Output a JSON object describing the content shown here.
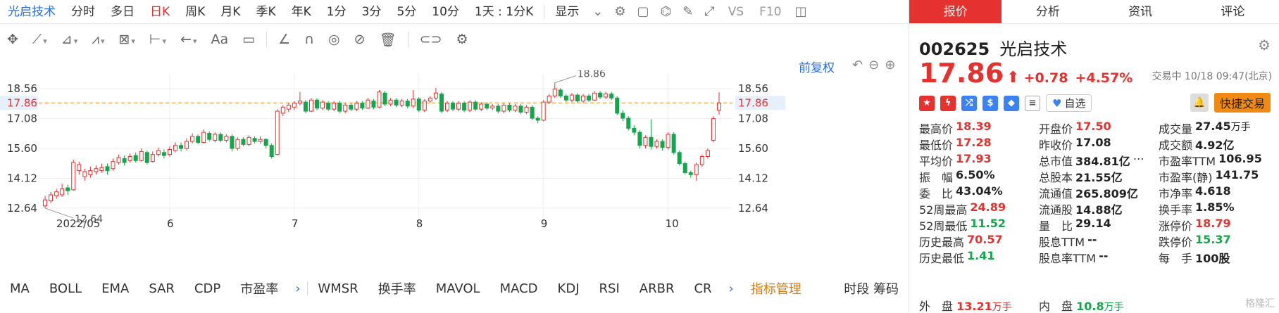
{
  "topbar": {
    "stock_name": "光启技术",
    "periods": [
      "分时",
      "多日",
      "日K",
      "周K",
      "月K",
      "季K",
      "年K",
      "1分",
      "3分",
      "5分",
      "10分",
      "1天 : 1分K"
    ],
    "selected": "日K",
    "display_label": "显示",
    "vs_label": "VS",
    "f10_label": "F10"
  },
  "adjust": {
    "label": "前复权"
  },
  "chart": {
    "price_levels": [
      "18.56",
      "17.08",
      "15.60",
      "14.12",
      "12.64"
    ],
    "current_price_label": "17.86",
    "high_label": "18.86",
    "low_label": "12.64",
    "months": [
      "2022/05",
      "6",
      "7",
      "8",
      "9",
      "10"
    ],
    "accent_up": "#e5322e",
    "accent_down": "#15a64b"
  },
  "chart_data": {
    "type": "candlestick",
    "y_range": [
      11.8,
      19.3
    ],
    "current": 17.86,
    "max_marker": 18.86,
    "min_marker": 12.64,
    "candles": [
      {
        "o": 12.75,
        "c": 13.05,
        "h": 13.25,
        "l": 12.64
      },
      {
        "o": 13.0,
        "c": 13.3,
        "h": 13.45,
        "l": 12.9
      },
      {
        "o": 13.25,
        "c": 13.45,
        "h": 13.6,
        "l": 13.1
      },
      {
        "o": 13.3,
        "c": 13.6,
        "h": 13.85,
        "l": 13.2
      },
      {
        "o": 13.65,
        "c": 13.5,
        "h": 13.8,
        "l": 13.3
      },
      {
        "o": 13.55,
        "c": 14.9,
        "h": 15.05,
        "l": 13.5
      },
      {
        "o": 14.5,
        "c": 14.8,
        "h": 14.95,
        "l": 14.3
      },
      {
        "o": 14.2,
        "c": 14.45,
        "h": 14.6,
        "l": 14.0
      },
      {
        "o": 14.3,
        "c": 14.5,
        "h": 14.7,
        "l": 14.15
      },
      {
        "o": 14.45,
        "c": 14.6,
        "h": 14.75,
        "l": 14.3
      },
      {
        "o": 14.5,
        "c": 14.65,
        "h": 14.85,
        "l": 14.4
      },
      {
        "o": 14.7,
        "c": 14.5,
        "h": 14.85,
        "l": 14.3
      },
      {
        "o": 14.6,
        "c": 14.95,
        "h": 15.1,
        "l": 14.5
      },
      {
        "o": 14.9,
        "c": 15.15,
        "h": 15.3,
        "l": 14.8
      },
      {
        "o": 15.1,
        "c": 14.9,
        "h": 15.25,
        "l": 14.75
      },
      {
        "o": 15.0,
        "c": 15.2,
        "h": 15.35,
        "l": 14.9
      },
      {
        "o": 15.25,
        "c": 15.0,
        "h": 15.4,
        "l": 14.9
      },
      {
        "o": 15.0,
        "c": 15.45,
        "h": 15.6,
        "l": 14.95
      },
      {
        "o": 15.4,
        "c": 14.9,
        "h": 15.5,
        "l": 14.8
      },
      {
        "o": 14.95,
        "c": 15.3,
        "h": 15.45,
        "l": 14.9
      },
      {
        "o": 15.3,
        "c": 15.5,
        "h": 15.65,
        "l": 15.2
      },
      {
        "o": 15.4,
        "c": 15.25,
        "h": 15.55,
        "l": 15.1
      },
      {
        "o": 15.3,
        "c": 15.55,
        "h": 15.7,
        "l": 15.2
      },
      {
        "o": 15.5,
        "c": 15.75,
        "h": 15.9,
        "l": 15.4
      },
      {
        "o": 15.75,
        "c": 15.6,
        "h": 15.9,
        "l": 15.45
      },
      {
        "o": 15.6,
        "c": 15.95,
        "h": 16.1,
        "l": 15.5
      },
      {
        "o": 15.95,
        "c": 16.2,
        "h": 16.35,
        "l": 15.85
      },
      {
        "o": 16.2,
        "c": 15.9,
        "h": 16.3,
        "l": 15.8
      },
      {
        "o": 15.9,
        "c": 16.4,
        "h": 16.55,
        "l": 15.85
      },
      {
        "o": 16.35,
        "c": 16.05,
        "h": 16.45,
        "l": 15.95
      },
      {
        "o": 16.0,
        "c": 16.3,
        "h": 16.4,
        "l": 15.9
      },
      {
        "o": 16.3,
        "c": 16.0,
        "h": 16.4,
        "l": 15.9
      },
      {
        "o": 16.0,
        "c": 16.2,
        "h": 16.3,
        "l": 15.9
      },
      {
        "o": 16.2,
        "c": 15.6,
        "h": 16.3,
        "l": 15.45
      },
      {
        "o": 15.6,
        "c": 16.05,
        "h": 16.15,
        "l": 15.5
      },
      {
        "o": 16.05,
        "c": 15.8,
        "h": 16.15,
        "l": 15.7
      },
      {
        "o": 15.8,
        "c": 16.15,
        "h": 16.25,
        "l": 15.7
      },
      {
        "o": 16.1,
        "c": 15.95,
        "h": 16.2,
        "l": 15.85
      },
      {
        "o": 15.95,
        "c": 16.05,
        "h": 16.2,
        "l": 15.85
      },
      {
        "o": 16.05,
        "c": 15.75,
        "h": 16.1,
        "l": 15.6
      },
      {
        "o": 15.75,
        "c": 15.2,
        "h": 15.85,
        "l": 15.1
      },
      {
        "o": 15.3,
        "c": 17.45,
        "h": 17.55,
        "l": 15.25
      },
      {
        "o": 17.35,
        "c": 17.65,
        "h": 17.75,
        "l": 17.2
      },
      {
        "o": 17.55,
        "c": 17.75,
        "h": 17.85,
        "l": 17.4
      },
      {
        "o": 17.65,
        "c": 17.85,
        "h": 17.95,
        "l": 17.5
      },
      {
        "o": 17.85,
        "c": 17.95,
        "h": 18.4,
        "l": 17.75
      },
      {
        "o": 17.9,
        "c": 17.45,
        "h": 18.0,
        "l": 17.35
      },
      {
        "o": 17.45,
        "c": 18.0,
        "h": 18.1,
        "l": 17.4
      },
      {
        "o": 18.0,
        "c": 17.6,
        "h": 18.1,
        "l": 17.5
      },
      {
        "o": 17.6,
        "c": 17.9,
        "h": 18.0,
        "l": 17.5
      },
      {
        "o": 17.85,
        "c": 17.55,
        "h": 17.95,
        "l": 17.45
      },
      {
        "o": 17.55,
        "c": 17.85,
        "h": 17.95,
        "l": 17.45
      },
      {
        "o": 17.85,
        "c": 17.45,
        "h": 17.95,
        "l": 17.35
      },
      {
        "o": 17.45,
        "c": 17.75,
        "h": 17.85,
        "l": 17.35
      },
      {
        "o": 17.75,
        "c": 17.55,
        "h": 17.85,
        "l": 17.45
      },
      {
        "o": 17.55,
        "c": 17.85,
        "h": 17.95,
        "l": 17.45
      },
      {
        "o": 17.85,
        "c": 17.6,
        "h": 17.95,
        "l": 17.5
      },
      {
        "o": 17.6,
        "c": 18.0,
        "h": 18.1,
        "l": 17.55
      },
      {
        "o": 17.95,
        "c": 17.65,
        "h": 18.05,
        "l": 17.55
      },
      {
        "o": 17.65,
        "c": 18.4,
        "h": 18.5,
        "l": 17.6
      },
      {
        "o": 18.35,
        "c": 17.8,
        "h": 18.45,
        "l": 17.7
      },
      {
        "o": 17.8,
        "c": 18.0,
        "h": 18.1,
        "l": 17.7
      },
      {
        "o": 18.0,
        "c": 17.75,
        "h": 18.1,
        "l": 17.65
      },
      {
        "o": 17.75,
        "c": 17.95,
        "h": 18.05,
        "l": 17.65
      },
      {
        "o": 17.95,
        "c": 17.7,
        "h": 18.05,
        "l": 17.6
      },
      {
        "o": 17.7,
        "c": 18.05,
        "h": 18.5,
        "l": 17.6
      },
      {
        "o": 18.05,
        "c": 17.5,
        "h": 18.15,
        "l": 17.4
      },
      {
        "o": 17.5,
        "c": 17.95,
        "h": 18.05,
        "l": 17.4
      },
      {
        "o": 17.95,
        "c": 18.1,
        "h": 18.2,
        "l": 17.85
      },
      {
        "o": 18.1,
        "c": 18.35,
        "h": 18.6,
        "l": 18.0
      },
      {
        "o": 18.3,
        "c": 17.45,
        "h": 18.4,
        "l": 17.35
      },
      {
        "o": 17.5,
        "c": 17.85,
        "h": 17.95,
        "l": 17.4
      },
      {
        "o": 17.85,
        "c": 17.55,
        "h": 17.95,
        "l": 17.45
      },
      {
        "o": 17.55,
        "c": 17.85,
        "h": 17.95,
        "l": 17.45
      },
      {
        "o": 17.85,
        "c": 17.5,
        "h": 17.95,
        "l": 17.4
      },
      {
        "o": 17.5,
        "c": 17.9,
        "h": 18.0,
        "l": 17.4
      },
      {
        "o": 17.9,
        "c": 17.55,
        "h": 18.0,
        "l": 17.45
      },
      {
        "o": 17.55,
        "c": 17.8,
        "h": 17.9,
        "l": 17.45
      },
      {
        "o": 17.8,
        "c": 17.6,
        "h": 17.9,
        "l": 17.5
      },
      {
        "o": 17.6,
        "c": 17.7,
        "h": 17.8,
        "l": 17.5
      },
      {
        "o": 17.7,
        "c": 17.45,
        "h": 17.8,
        "l": 17.35
      },
      {
        "o": 17.45,
        "c": 17.75,
        "h": 17.85,
        "l": 17.35
      },
      {
        "o": 17.75,
        "c": 17.5,
        "h": 17.85,
        "l": 17.4
      },
      {
        "o": 17.5,
        "c": 17.7,
        "h": 17.8,
        "l": 17.4
      },
      {
        "o": 17.7,
        "c": 17.4,
        "h": 17.8,
        "l": 17.3
      },
      {
        "o": 17.4,
        "c": 17.65,
        "h": 17.75,
        "l": 17.3
      },
      {
        "o": 17.65,
        "c": 17.1,
        "h": 17.75,
        "l": 17.0
      },
      {
        "o": 17.1,
        "c": 17.0,
        "h": 17.2,
        "l": 16.85
      },
      {
        "o": 17.0,
        "c": 17.9,
        "h": 18.0,
        "l": 16.95
      },
      {
        "o": 17.9,
        "c": 18.2,
        "h": 18.3,
        "l": 17.8
      },
      {
        "o": 18.2,
        "c": 18.55,
        "h": 18.86,
        "l": 18.1
      },
      {
        "o": 18.5,
        "c": 18.2,
        "h": 18.6,
        "l": 18.1
      },
      {
        "o": 18.2,
        "c": 18.0,
        "h": 18.3,
        "l": 17.9
      },
      {
        "o": 18.0,
        "c": 18.25,
        "h": 18.35,
        "l": 17.9
      },
      {
        "o": 18.25,
        "c": 17.95,
        "h": 18.35,
        "l": 17.85
      },
      {
        "o": 17.95,
        "c": 18.2,
        "h": 18.3,
        "l": 17.85
      },
      {
        "o": 18.2,
        "c": 18.0,
        "h": 18.3,
        "l": 17.9
      },
      {
        "o": 18.0,
        "c": 18.35,
        "h": 18.45,
        "l": 17.95
      },
      {
        "o": 18.35,
        "c": 18.15,
        "h": 18.45,
        "l": 18.05
      },
      {
        "o": 18.15,
        "c": 18.3,
        "h": 18.4,
        "l": 18.05
      },
      {
        "o": 18.3,
        "c": 18.1,
        "h": 18.4,
        "l": 18.0
      },
      {
        "o": 18.1,
        "c": 17.35,
        "h": 18.2,
        "l": 17.25
      },
      {
        "o": 17.35,
        "c": 17.1,
        "h": 17.5,
        "l": 16.95
      },
      {
        "o": 17.1,
        "c": 16.6,
        "h": 17.2,
        "l": 16.5
      },
      {
        "o": 16.6,
        "c": 16.4,
        "h": 16.75,
        "l": 16.25
      },
      {
        "o": 16.4,
        "c": 15.75,
        "h": 16.5,
        "l": 15.6
      },
      {
        "o": 15.75,
        "c": 16.15,
        "h": 16.25,
        "l": 15.6
      },
      {
        "o": 16.15,
        "c": 15.7,
        "h": 17.05,
        "l": 15.55
      },
      {
        "o": 15.7,
        "c": 15.95,
        "h": 16.05,
        "l": 15.6
      },
      {
        "o": 15.95,
        "c": 15.65,
        "h": 16.05,
        "l": 15.5
      },
      {
        "o": 15.65,
        "c": 16.3,
        "h": 16.4,
        "l": 15.55
      },
      {
        "o": 16.3,
        "c": 15.4,
        "h": 16.4,
        "l": 15.3
      },
      {
        "o": 15.4,
        "c": 14.85,
        "h": 15.5,
        "l": 14.75
      },
      {
        "o": 14.85,
        "c": 14.4,
        "h": 14.95,
        "l": 14.3
      },
      {
        "o": 14.4,
        "c": 14.3,
        "h": 14.5,
        "l": 14.15
      },
      {
        "o": 14.3,
        "c": 14.8,
        "h": 14.9,
        "l": 14.0
      },
      {
        "o": 14.8,
        "c": 15.2,
        "h": 15.3,
        "l": 14.7
      },
      {
        "o": 15.2,
        "c": 15.5,
        "h": 15.6,
        "l": 15.1
      },
      {
        "o": 16.0,
        "c": 17.08,
        "h": 17.2,
        "l": 15.9
      },
      {
        "o": 17.5,
        "c": 17.86,
        "h": 18.39,
        "l": 17.28
      }
    ]
  },
  "indicators": {
    "items": [
      "MA",
      "BOLL",
      "EMA",
      "SAR",
      "CDP",
      "市盈率"
    ],
    "items2": [
      "WMSR",
      "换手率",
      "MAVOL",
      "MACD",
      "KDJ",
      "RSI",
      "ARBR",
      "CR"
    ],
    "manage_label": "指标管理",
    "right_label": "时段 筹码"
  },
  "quote": {
    "tabs": [
      "报价",
      "分析",
      "资讯",
      "评论"
    ],
    "code": "002625",
    "name": "光启技术",
    "price": "17.86",
    "arrow": "⬆",
    "change": "+0.78",
    "change_pct": "+4.57%",
    "status_time": "交易中 10/18 09:47(北京)",
    "watch_label": "自选",
    "trade_label": "快捷交易",
    "rows": [
      [
        {
          "l": "最高价",
          "v": "18.39",
          "c": "red"
        },
        {
          "l": "开盘价",
          "v": "17.50",
          "c": "red"
        },
        {
          "l": "成交量",
          "v": "27.45",
          "u": "万手",
          "c": ""
        }
      ],
      [
        {
          "l": "最低价",
          "v": "17.28",
          "c": "red"
        },
        {
          "l": "昨收价",
          "v": "17.08",
          "c": ""
        },
        {
          "l": "成交额",
          "v": "4.92亿",
          "c": ""
        }
      ],
      [
        {
          "l": "平均价",
          "v": "17.93",
          "c": "red"
        },
        {
          "l": "总市值",
          "v": "384.81亿",
          "c": ""
        },
        {
          "l": "市盈率TTM",
          "v": "106.95",
          "c": ""
        }
      ],
      [
        {
          "l": "振　幅",
          "v": "6.50%",
          "c": ""
        },
        {
          "l": "总股本",
          "v": "21.55亿",
          "c": ""
        },
        {
          "l": "市盈率(静)",
          "v": "141.75",
          "c": ""
        }
      ],
      [
        {
          "l": "委　比",
          "v": "43.04%",
          "c": ""
        },
        {
          "l": "流通值",
          "v": "265.809亿",
          "c": ""
        },
        {
          "l": "市净率",
          "v": "4.618",
          "c": ""
        }
      ],
      [
        {
          "l": "52周最高",
          "v": "24.89",
          "c": "red"
        },
        {
          "l": "流通股",
          "v": "14.88亿",
          "c": ""
        },
        {
          "l": "换手率",
          "v": "1.85%",
          "c": ""
        }
      ],
      [
        {
          "l": "52周最低",
          "v": "11.52",
          "c": "green"
        },
        {
          "l": "量　比",
          "v": "29.14",
          "c": ""
        },
        {
          "l": "涨停价",
          "v": "18.79",
          "c": "red"
        }
      ],
      [
        {
          "l": "历史最高",
          "v": "70.57",
          "c": "red"
        },
        {
          "l": "股息TTM",
          "v": "--",
          "c": ""
        },
        {
          "l": "跌停价",
          "v": "15.37",
          "c": "green"
        }
      ],
      [
        {
          "l": "历史最低",
          "v": "1.41",
          "c": "green"
        },
        {
          "l": "股息率TTM",
          "v": "--",
          "c": ""
        },
        {
          "l": "每　手",
          "v": "100股",
          "c": ""
        }
      ]
    ],
    "foot": {
      "out_label": "外　盘",
      "out_val": "13.21",
      "out_unit": "万手",
      "in_label": "内　盘",
      "in_val": "10.8",
      "in_unit": "万手"
    },
    "watermark": "格隆汇"
  }
}
